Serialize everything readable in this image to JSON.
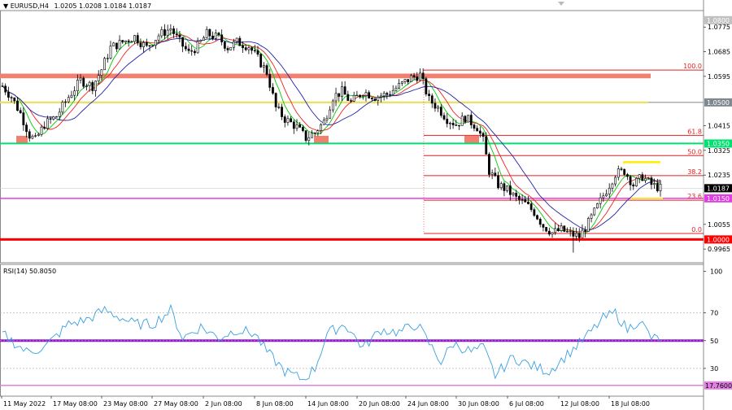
{
  "header": {
    "symbol": "EURUSD,H4",
    "ohlc": "1.0205 1.0208 1.0184 1.0187"
  },
  "rsi_header": "RSI(14) 50.8050",
  "colors": {
    "candle": "#000000",
    "ma_fast": "#00cc00",
    "ma_mid": "#ee2222",
    "ma_slow": "#2222aa",
    "fib": "#e02020",
    "resistance_band": "#f08070",
    "level_1_0500": "#e8e070",
    "level_1_0350": "#00e070",
    "level_1_0150": "#e040e0",
    "level_1_0000": "#ff0000",
    "rsi_line": "#3aa0e0",
    "rsi_mid": "#8020c0",
    "rsi_low": "#e080e0",
    "top_swing": "#ffee00"
  },
  "chart_data": [
    {
      "type": "candlestick",
      "series": [
        {
          "name": "EURUSD,H4",
          "values": []
        }
      ],
      "ylim": [
        0.9915,
        1.0835
      ],
      "yticks": [
        "1.0775",
        "1.0685",
        "1.0595",
        "1.0415",
        "1.0325",
        "1.0235",
        "1.0055",
        "0.9965"
      ],
      "xticks": [
        "11 May 2022",
        "17 May 08:00",
        "23 May 08:00",
        "27 May 08:00",
        "2 Jun 08:00",
        "8 Jun 08:00",
        "14 Jun 08:00",
        "20 Jun 08:00",
        "24 Jun 08:00",
        "30 Jun 08:00",
        "6 Jul 08:00",
        "12 Jul 08:00",
        "18 Jul 08:00"
      ],
      "price_tags": [
        {
          "label": "1.0800",
          "value": 1.08,
          "bg": "#c0c0c0",
          "fg": "#ffffff"
        },
        {
          "label": "1.0500",
          "value": 1.05,
          "bg": "#808890",
          "fg": "#ffffff"
        },
        {
          "label": "1.0350",
          "value": 1.035,
          "bg": "#00e070",
          "fg": "#ffffff"
        },
        {
          "label": "1.0187",
          "value": 1.0187,
          "bg": "#000000",
          "fg": "#ffffff"
        },
        {
          "label": "1.0150",
          "value": 1.015,
          "bg": "#e040e0",
          "fg": "#ffffff"
        },
        {
          "label": "1.0000",
          "value": 1.0,
          "bg": "#ff0000",
          "fg": "#ffffff"
        }
      ],
      "fib_levels": [
        {
          "label": "100.0",
          "value": 1.0618
        },
        {
          "label": "61.8",
          "value": 1.038
        },
        {
          "label": "50.0",
          "value": 1.0306
        },
        {
          "label": "38.2",
          "value": 1.0233
        },
        {
          "label": "23.6",
          "value": 1.0143
        },
        {
          "label": "0.0",
          "value": 1.0022
        }
      ]
    },
    {
      "type": "line",
      "title": "RSI(14) 50.8050",
      "ylim": [
        10,
        105
      ],
      "yticks": [
        "100",
        "70",
        "50",
        "30",
        "17.7600"
      ],
      "levels": [
        70,
        50,
        30,
        17.76
      ],
      "series": [
        {
          "name": "RSI(14)",
          "values": []
        }
      ]
    }
  ]
}
